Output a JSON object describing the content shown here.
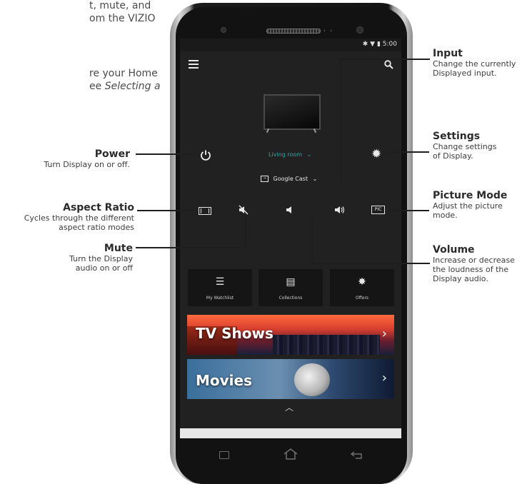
{
  "page_text": {
    "line1": "t, mute, and",
    "line2": "om the VIZIO",
    "line3": "re your Home",
    "line4_plain": "ee ",
    "line4_italic": "Selecting a"
  },
  "callouts": {
    "power": {
      "title": "Power",
      "desc": "Turn Display on or off."
    },
    "aspect": {
      "title": "Aspect Ratio",
      "desc1": "Cycles through the different",
      "desc2": "aspect ratio modes"
    },
    "mute": {
      "title": "Mute",
      "desc1": "Turn the Display",
      "desc2": "audio on or off"
    },
    "input": {
      "title": "Input",
      "desc1": "Change the currently",
      "desc2": "Displayed input."
    },
    "settings": {
      "title": "Settings",
      "desc1": "Change settings",
      "desc2": "of Display."
    },
    "picture": {
      "title": "Picture Mode",
      "desc1": "Adjust the picture",
      "desc2": "mode."
    },
    "volume": {
      "title": "Volume",
      "desc1": "Increase or decrease",
      "desc2": "the loudness of the",
      "desc3": "Display audio."
    }
  },
  "phone": {
    "status_time": "5:00",
    "device_name": "Living room",
    "input_name": "Google Cast",
    "pic_label": "PIC",
    "tiles": [
      "My Watchlist",
      "Collections",
      "Offers"
    ],
    "banners": [
      "TV Shows",
      "Movies"
    ]
  },
  "colors": {
    "accent": "#38a6a0",
    "screen_bg": "#212121",
    "tile_bg": "#151515"
  }
}
